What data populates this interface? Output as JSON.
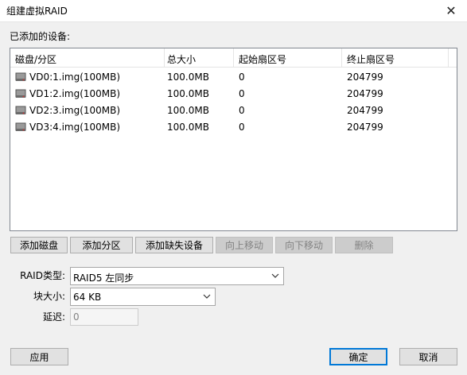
{
  "window": {
    "title": "组建虚拟RAID",
    "close_glyph": "✕"
  },
  "devices_label": "已添加的设备:",
  "table": {
    "columns": [
      "磁盘/分区",
      "总大小",
      "起始扇区号",
      "终止扇区号"
    ],
    "rows": [
      {
        "icon": "disk-icon",
        "name": "VD0:1.img(100MB)",
        "size": "100.0MB",
        "start": "0",
        "end": "204799"
      },
      {
        "icon": "disk-icon",
        "name": "VD1:2.img(100MB)",
        "size": "100.0MB",
        "start": "0",
        "end": "204799"
      },
      {
        "icon": "disk-icon",
        "name": "VD2:3.img(100MB)",
        "size": "100.0MB",
        "start": "0",
        "end": "204799"
      },
      {
        "icon": "disk-icon",
        "name": "VD3:4.img(100MB)",
        "size": "100.0MB",
        "start": "0",
        "end": "204799"
      }
    ]
  },
  "buttons": {
    "add_disk": "添加磁盘",
    "add_partition": "添加分区",
    "add_missing": "添加缺失设备",
    "move_up": "向上移动",
    "move_down": "向下移动",
    "delete": "删除"
  },
  "form": {
    "raid_type_label": "RAID类型:",
    "raid_type_value": "RAID5 左同步",
    "block_size_label": "块大小:",
    "block_size_value": "64 KB",
    "delay_label": "延迟:",
    "delay_value": "0"
  },
  "footer": {
    "apply": "应用",
    "ok": "确定",
    "cancel": "取消"
  },
  "colors": {
    "accent": "#0078d7",
    "disabled_bg": "#cccccc"
  }
}
